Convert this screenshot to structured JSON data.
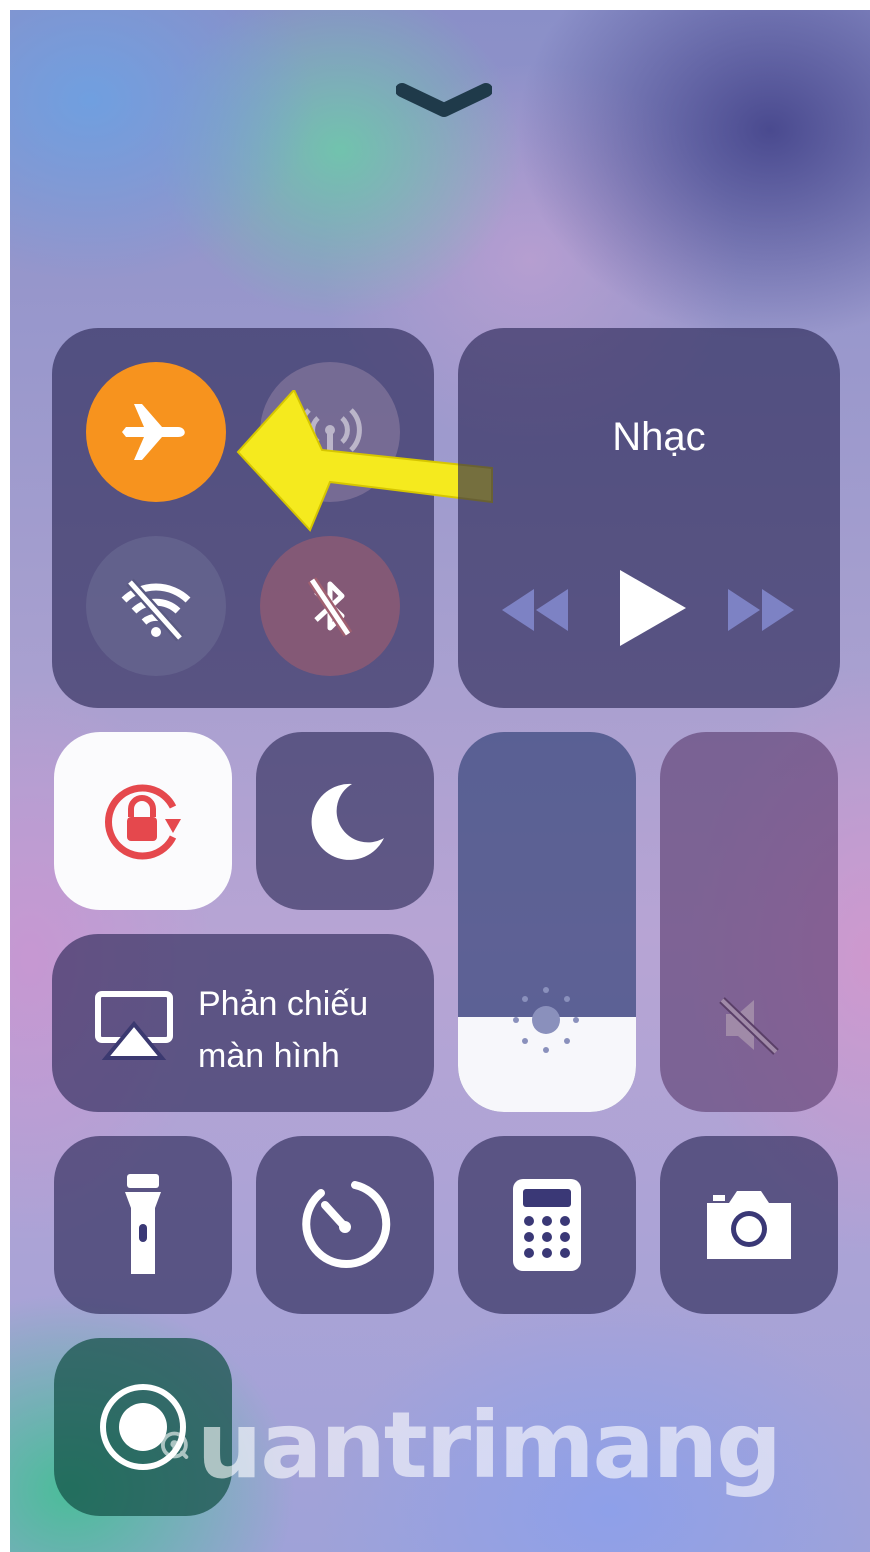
{
  "control_center": {
    "connectivity": {
      "airplane_mode": {
        "icon": "airplane-icon",
        "active": true,
        "color": "#F7931E"
      },
      "cellular": {
        "icon": "cellular-antenna-icon",
        "active": false
      },
      "wifi": {
        "icon": "wifi-off-icon",
        "active": false
      },
      "bluetooth": {
        "icon": "bluetooth-off-icon",
        "active": false
      }
    },
    "music": {
      "title": "Nhạc",
      "rewind_icon": "rewind-icon",
      "play_icon": "play-icon",
      "forward_icon": "fast-forward-icon"
    },
    "orientation_lock": {
      "icon": "orientation-lock-icon",
      "active": true,
      "color": "#E5484D"
    },
    "do_not_disturb": {
      "icon": "moon-icon",
      "active": false
    },
    "screen_mirroring": {
      "line1": "Phản chiếu",
      "line2": "màn hình",
      "icon": "airplay-icon"
    },
    "brightness": {
      "level": 0.25,
      "icon": "sun-icon"
    },
    "volume": {
      "level": 0.0,
      "icon": "speaker-muted-icon"
    },
    "shortcuts": [
      {
        "name": "flashlight",
        "icon": "flashlight-icon"
      },
      {
        "name": "timer",
        "icon": "timer-icon"
      },
      {
        "name": "calculator",
        "icon": "calculator-icon"
      },
      {
        "name": "camera",
        "icon": "camera-icon"
      }
    ],
    "screen_recording": {
      "icon": "screen-record-icon"
    }
  },
  "annotation": {
    "arrow_color": "#F5EA1E"
  },
  "watermark": {
    "text": "uantrimang"
  }
}
